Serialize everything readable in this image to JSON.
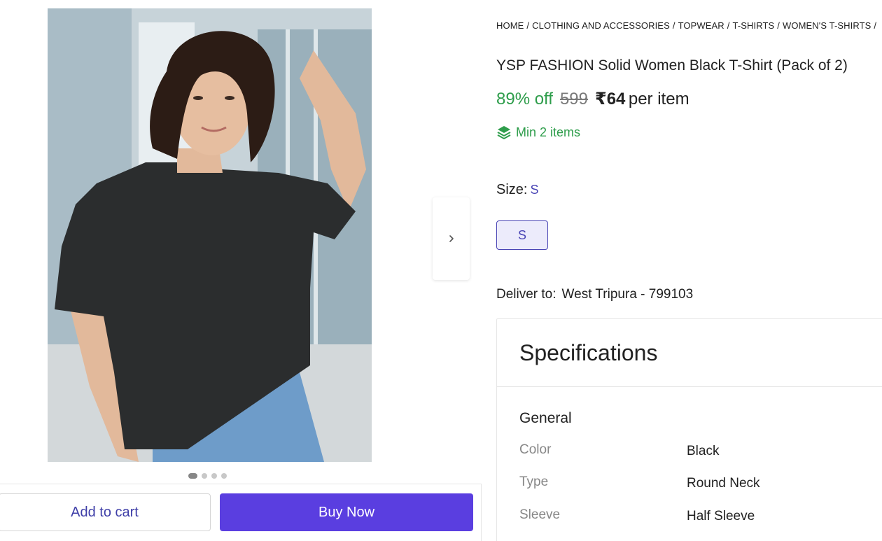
{
  "breadcrumb": [
    "HOME",
    "CLOTHING AND ACCESSORIES",
    "TOPWEAR",
    "T-SHIRTS",
    "WOMEN'S T-SHIRTS"
  ],
  "product": {
    "title": "YSP FASHION Solid Women Black T-Shirt (Pack of 2)",
    "discount": "89% off",
    "mrp": "599",
    "price": "₹64",
    "price_suffix": "per item",
    "min_items": "Min 2 items"
  },
  "size": {
    "label": "Size:",
    "selected": "S",
    "options": [
      "S"
    ]
  },
  "delivery": {
    "label": "Deliver to:",
    "location": "West Tripura - 799103"
  },
  "specifications": {
    "title": "Specifications",
    "group": "General",
    "rows": [
      {
        "key": "Color",
        "value": "Black"
      },
      {
        "key": "Type",
        "value": "Round Neck"
      },
      {
        "key": "Sleeve",
        "value": "Half Sleeve"
      }
    ]
  },
  "gallery": {
    "image_count": 4,
    "active_index": 0
  },
  "actions": {
    "add_to_cart": "Add to cart",
    "buy_now": "Buy Now"
  },
  "colors": {
    "accent": "#5a3ee0",
    "discount_green": "#2e9d4b",
    "size_purple": "#4a45b5",
    "size_bg": "#ecebfb"
  },
  "icons": {
    "next": "chevron-right-icon",
    "min_items": "layers-icon"
  }
}
